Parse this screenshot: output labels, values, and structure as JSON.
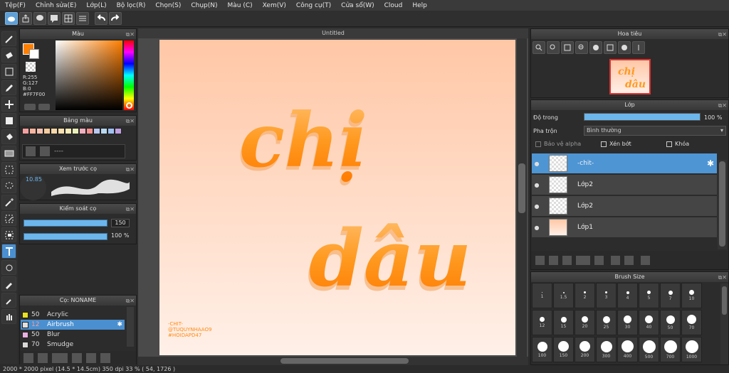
{
  "menu": [
    "Tệp(F)",
    "Chỉnh sửa(E)",
    "Lớp(L)",
    "Bộ lọc(R)",
    "Chọn(S)",
    "Chụp(N)",
    "Màu (C)",
    "Xem(V)",
    "Công cụ(T)",
    "Cửa sổ(W)",
    "Cloud",
    "Help"
  ],
  "canvas": {
    "tab_title": "Untitled",
    "text_line1": "chị",
    "text_line2": "dâu",
    "watermark": [
      "-CHIT-",
      "@TUQUYNHAAO9",
      "#HOIDAPD47"
    ]
  },
  "color_panel": {
    "title": "Màu",
    "r": "R:255",
    "g": "G:127",
    "b": "B:0",
    "hex": "#FF7F00",
    "fg_color": "#FF7F00"
  },
  "palette": {
    "title": "Bảng màu",
    "placeholder": "----",
    "colors": [
      "#f5a0a0",
      "#f7b5a0",
      "#f5c0b0",
      "#f5cba0",
      "#f8d8a8",
      "#f9e0b0",
      "#f8ecb8",
      "#e8f0b8",
      "#f0b0c0",
      "#f59090",
      "#b8c8f0",
      "#b8d8f0",
      "#a0c0f0",
      "#c0a0e0"
    ]
  },
  "brush_preview": {
    "title": "Xem trước cọ",
    "size": "10.85"
  },
  "brush_control": {
    "title": "Kiểm soát cọ",
    "size_val": "150",
    "opacity_val": "100 %"
  },
  "brush_list": {
    "title": "Cọ: NONAME",
    "items": [
      {
        "size": "50",
        "name": "Acrylic",
        "color": "#e8e020"
      },
      {
        "size": "12",
        "name": "Airbrush",
        "color": "#e0e0e0"
      },
      {
        "size": "50",
        "name": "Blur",
        "color": "#e8b0e0"
      },
      {
        "size": "70",
        "name": "Smudge",
        "color": "#d8d8d8"
      }
    ]
  },
  "navigator": {
    "title": "Hoa tiêu"
  },
  "layers": {
    "title": "Lớp",
    "opacity_label": "Độ trong",
    "opacity_value": "100 %",
    "opacity_fraction": 1.0,
    "blend_label": "Pha trộn",
    "blend_value": "Bình thường",
    "protect_alpha": "Bảo vệ alpha",
    "clipping": "Xén bớt",
    "lock": "Khóa",
    "items": [
      {
        "name": "-chit-",
        "selected": true
      },
      {
        "name": "Lớp2",
        "selected": false
      },
      {
        "name": "Lớp2",
        "selected": false
      },
      {
        "name": "Lớp1",
        "selected": false
      }
    ]
  },
  "brush_size": {
    "title": "Brush Size",
    "sizes": [
      "1",
      "1.5",
      "2",
      "3",
      "4",
      "5",
      "7",
      "10",
      "12",
      "15",
      "20",
      "25",
      "30",
      "40",
      "50",
      "70",
      "100",
      "150",
      "200",
      "300",
      "400",
      "500",
      "700",
      "1000"
    ]
  },
  "status": "2000 * 2000 pixel  (14.5 * 14.5cm)  350 dpi  33 %  ( 54, 1726 )"
}
